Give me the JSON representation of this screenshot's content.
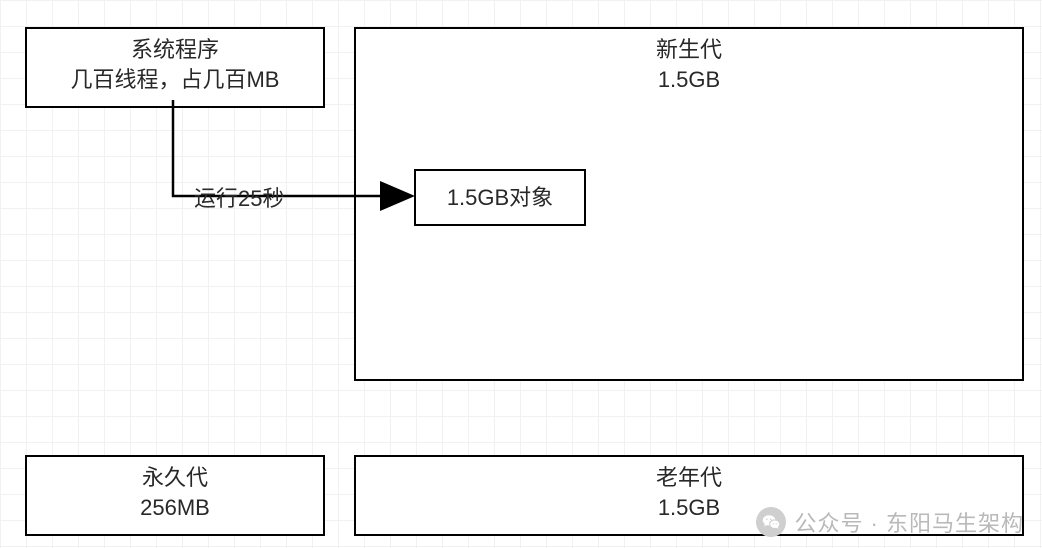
{
  "boxes": {
    "system_program": {
      "line1": "系统程序",
      "line2": "几百线程，占几百MB"
    },
    "young_gen": {
      "line1": "新生代",
      "line2": "1.5GB"
    },
    "object": {
      "label": "1.5GB对象"
    },
    "perm_gen": {
      "line1": "永久代",
      "line2": "256MB"
    },
    "old_gen": {
      "line1": "老年代",
      "line2": "1.5GB"
    }
  },
  "edges": {
    "run25s": {
      "label": "运行25秒"
    }
  },
  "watermark": {
    "text": "公众号 · 东阳马生架构"
  }
}
